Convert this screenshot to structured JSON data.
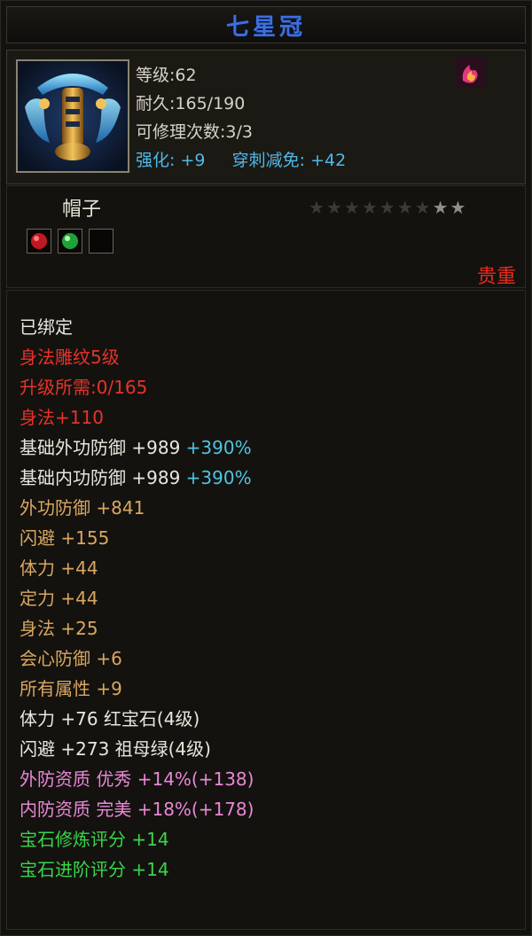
{
  "title": "七星冠",
  "item": {
    "level": "等级:62",
    "durability": "耐久:165/190",
    "repair": "可修理次数:3/3",
    "enhance_label": "强化:",
    "enhance_value": "+9",
    "pierce_label": "穿刺减免:",
    "pierce_value": "+42",
    "type": "帽子",
    "rarity": "贵重",
    "stars_total": 9,
    "stars_lit": 2,
    "icon": "crown-helmet-icon",
    "corner_icon": "flame-badge-icon",
    "sockets": [
      "ruby-gem-icon",
      "emerald-gem-icon",
      "empty-socket"
    ]
  },
  "attributes": [
    {
      "text": "已绑定",
      "color": "white"
    },
    {
      "text": "身法雕纹5级",
      "color": "red"
    },
    {
      "text": "升级所需:0/165",
      "color": "red"
    },
    {
      "text": "身法+110",
      "color": "red"
    },
    {
      "text": "基础外功防御 +989",
      "extra": "+390%",
      "color": "white"
    },
    {
      "text": "基础内功防御 +989",
      "extra": "+390%",
      "color": "white"
    },
    {
      "text": "外功防御 +841",
      "color": "gold"
    },
    {
      "text": "闪避 +155",
      "color": "gold"
    },
    {
      "text": "体力 +44",
      "color": "gold"
    },
    {
      "text": "定力 +44",
      "color": "gold"
    },
    {
      "text": "身法 +25",
      "color": "gold"
    },
    {
      "text": "会心防御 +6",
      "color": "gold"
    },
    {
      "text": "所有属性 +9",
      "color": "gold"
    },
    {
      "text": "体力 +76 红宝石(4级)",
      "color": "white"
    },
    {
      "text": "闪避 +273 祖母绿(4级)",
      "color": "white"
    },
    {
      "text": "外防资质  优秀 +14%(+138)",
      "color": "pink"
    },
    {
      "text": "内防资质  完美 +18%(+178)",
      "color": "pink"
    },
    {
      "text": "宝石修炼评分 +14",
      "color": "green"
    },
    {
      "text": "宝石进阶评分 +14",
      "color": "green"
    }
  ],
  "colors": {
    "title": "#3d6fe0",
    "enhance": "#4fb8e8",
    "rarity": "#e82a1c"
  }
}
